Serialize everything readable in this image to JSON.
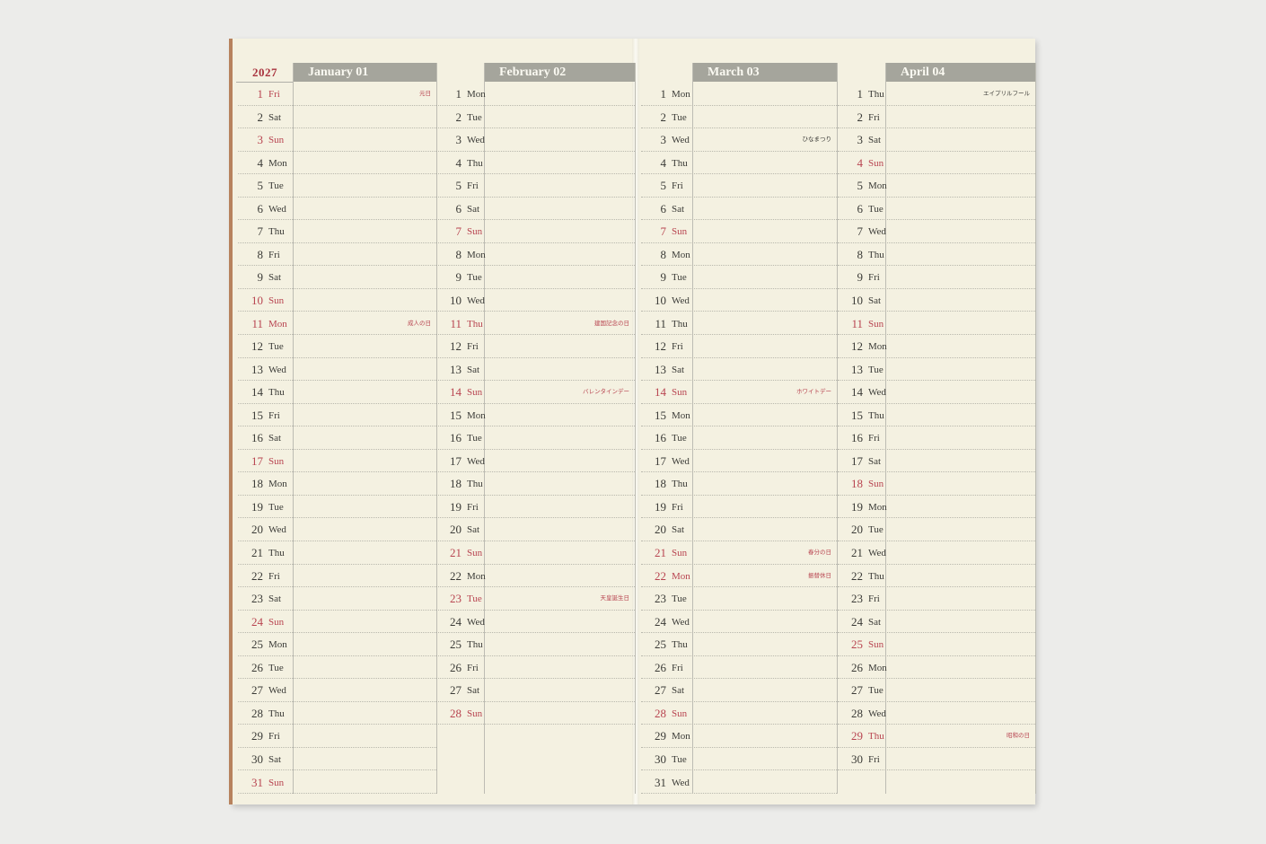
{
  "year": "2027",
  "colors": {
    "accent_red": "#b84450",
    "header_gray": "#a5a59c",
    "paper": "#f4f1e1",
    "spine": "#b7825d"
  },
  "months": [
    {
      "header": "January 01",
      "days": [
        {
          "num": "1",
          "name": "Fri",
          "holiday": true,
          "event": "元日",
          "event_color": "red"
        },
        {
          "num": "2",
          "name": "Sat"
        },
        {
          "num": "3",
          "name": "Sun",
          "holiday": true
        },
        {
          "num": "4",
          "name": "Mon"
        },
        {
          "num": "5",
          "name": "Tue"
        },
        {
          "num": "6",
          "name": "Wed"
        },
        {
          "num": "7",
          "name": "Thu"
        },
        {
          "num": "8",
          "name": "Fri"
        },
        {
          "num": "9",
          "name": "Sat"
        },
        {
          "num": "10",
          "name": "Sun",
          "holiday": true
        },
        {
          "num": "11",
          "name": "Mon",
          "holiday": true,
          "event": "成人の日",
          "event_color": "red"
        },
        {
          "num": "12",
          "name": "Tue"
        },
        {
          "num": "13",
          "name": "Wed"
        },
        {
          "num": "14",
          "name": "Thu"
        },
        {
          "num": "15",
          "name": "Fri"
        },
        {
          "num": "16",
          "name": "Sat"
        },
        {
          "num": "17",
          "name": "Sun",
          "holiday": true
        },
        {
          "num": "18",
          "name": "Mon"
        },
        {
          "num": "19",
          "name": "Tue"
        },
        {
          "num": "20",
          "name": "Wed"
        },
        {
          "num": "21",
          "name": "Thu"
        },
        {
          "num": "22",
          "name": "Fri"
        },
        {
          "num": "23",
          "name": "Sat"
        },
        {
          "num": "24",
          "name": "Sun",
          "holiday": true
        },
        {
          "num": "25",
          "name": "Mon"
        },
        {
          "num": "26",
          "name": "Tue"
        },
        {
          "num": "27",
          "name": "Wed"
        },
        {
          "num": "28",
          "name": "Thu"
        },
        {
          "num": "29",
          "name": "Fri"
        },
        {
          "num": "30",
          "name": "Sat"
        },
        {
          "num": "31",
          "name": "Sun",
          "holiday": true
        }
      ]
    },
    {
      "header": "February 02",
      "days": [
        {
          "num": "1",
          "name": "Mon"
        },
        {
          "num": "2",
          "name": "Tue"
        },
        {
          "num": "3",
          "name": "Wed"
        },
        {
          "num": "4",
          "name": "Thu"
        },
        {
          "num": "5",
          "name": "Fri"
        },
        {
          "num": "6",
          "name": "Sat"
        },
        {
          "num": "7",
          "name": "Sun",
          "holiday": true
        },
        {
          "num": "8",
          "name": "Mon"
        },
        {
          "num": "9",
          "name": "Tue"
        },
        {
          "num": "10",
          "name": "Wed"
        },
        {
          "num": "11",
          "name": "Thu",
          "holiday": true,
          "event": "建国記念の日",
          "event_color": "red"
        },
        {
          "num": "12",
          "name": "Fri"
        },
        {
          "num": "13",
          "name": "Sat"
        },
        {
          "num": "14",
          "name": "Sun",
          "holiday": true,
          "event": "バレンタインデー",
          "event_color": "red"
        },
        {
          "num": "15",
          "name": "Mon"
        },
        {
          "num": "16",
          "name": "Tue"
        },
        {
          "num": "17",
          "name": "Wed"
        },
        {
          "num": "18",
          "name": "Thu"
        },
        {
          "num": "19",
          "name": "Fri"
        },
        {
          "num": "20",
          "name": "Sat"
        },
        {
          "num": "21",
          "name": "Sun",
          "holiday": true
        },
        {
          "num": "22",
          "name": "Mon"
        },
        {
          "num": "23",
          "name": "Tue",
          "holiday": true,
          "event": "天皇誕生日",
          "event_color": "red"
        },
        {
          "num": "24",
          "name": "Wed"
        },
        {
          "num": "25",
          "name": "Thu"
        },
        {
          "num": "26",
          "name": "Fri"
        },
        {
          "num": "27",
          "name": "Sat"
        },
        {
          "num": "28",
          "name": "Sun",
          "holiday": true
        }
      ]
    },
    {
      "header": "March 03",
      "days": [
        {
          "num": "1",
          "name": "Mon"
        },
        {
          "num": "2",
          "name": "Tue"
        },
        {
          "num": "3",
          "name": "Wed",
          "event": "ひなまつり",
          "event_color": "black"
        },
        {
          "num": "4",
          "name": "Thu"
        },
        {
          "num": "5",
          "name": "Fri"
        },
        {
          "num": "6",
          "name": "Sat"
        },
        {
          "num": "7",
          "name": "Sun",
          "holiday": true
        },
        {
          "num": "8",
          "name": "Mon"
        },
        {
          "num": "9",
          "name": "Tue"
        },
        {
          "num": "10",
          "name": "Wed"
        },
        {
          "num": "11",
          "name": "Thu"
        },
        {
          "num": "12",
          "name": "Fri"
        },
        {
          "num": "13",
          "name": "Sat"
        },
        {
          "num": "14",
          "name": "Sun",
          "holiday": true,
          "event": "ホワイトデー",
          "event_color": "red"
        },
        {
          "num": "15",
          "name": "Mon"
        },
        {
          "num": "16",
          "name": "Tue"
        },
        {
          "num": "17",
          "name": "Wed"
        },
        {
          "num": "18",
          "name": "Thu"
        },
        {
          "num": "19",
          "name": "Fri"
        },
        {
          "num": "20",
          "name": "Sat"
        },
        {
          "num": "21",
          "name": "Sun",
          "holiday": true,
          "event": "春分の日",
          "event_color": "red"
        },
        {
          "num": "22",
          "name": "Mon",
          "holiday": true,
          "event": "振替休日",
          "event_color": "red"
        },
        {
          "num": "23",
          "name": "Tue"
        },
        {
          "num": "24",
          "name": "Wed"
        },
        {
          "num": "25",
          "name": "Thu"
        },
        {
          "num": "26",
          "name": "Fri"
        },
        {
          "num": "27",
          "name": "Sat"
        },
        {
          "num": "28",
          "name": "Sun",
          "holiday": true
        },
        {
          "num": "29",
          "name": "Mon"
        },
        {
          "num": "30",
          "name": "Tue"
        },
        {
          "num": "31",
          "name": "Wed"
        }
      ]
    },
    {
      "header": "April 04",
      "days": [
        {
          "num": "1",
          "name": "Thu",
          "event": "エイプリルフール",
          "event_color": "black"
        },
        {
          "num": "2",
          "name": "Fri"
        },
        {
          "num": "3",
          "name": "Sat"
        },
        {
          "num": "4",
          "name": "Sun",
          "holiday": true
        },
        {
          "num": "5",
          "name": "Mon"
        },
        {
          "num": "6",
          "name": "Tue"
        },
        {
          "num": "7",
          "name": "Wed"
        },
        {
          "num": "8",
          "name": "Thu"
        },
        {
          "num": "9",
          "name": "Fri"
        },
        {
          "num": "10",
          "name": "Sat"
        },
        {
          "num": "11",
          "name": "Sun",
          "holiday": true
        },
        {
          "num": "12",
          "name": "Mon"
        },
        {
          "num": "13",
          "name": "Tue"
        },
        {
          "num": "14",
          "name": "Wed"
        },
        {
          "num": "15",
          "name": "Thu"
        },
        {
          "num": "16",
          "name": "Fri"
        },
        {
          "num": "17",
          "name": "Sat"
        },
        {
          "num": "18",
          "name": "Sun",
          "holiday": true
        },
        {
          "num": "19",
          "name": "Mon"
        },
        {
          "num": "20",
          "name": "Tue"
        },
        {
          "num": "21",
          "name": "Wed"
        },
        {
          "num": "22",
          "name": "Thu"
        },
        {
          "num": "23",
          "name": "Fri"
        },
        {
          "num": "24",
          "name": "Sat"
        },
        {
          "num": "25",
          "name": "Sun",
          "holiday": true
        },
        {
          "num": "26",
          "name": "Mon"
        },
        {
          "num": "27",
          "name": "Tue"
        },
        {
          "num": "28",
          "name": "Wed"
        },
        {
          "num": "29",
          "name": "Thu",
          "holiday": true,
          "event": "昭和の日",
          "event_color": "red"
        },
        {
          "num": "30",
          "name": "Fri"
        }
      ]
    }
  ]
}
